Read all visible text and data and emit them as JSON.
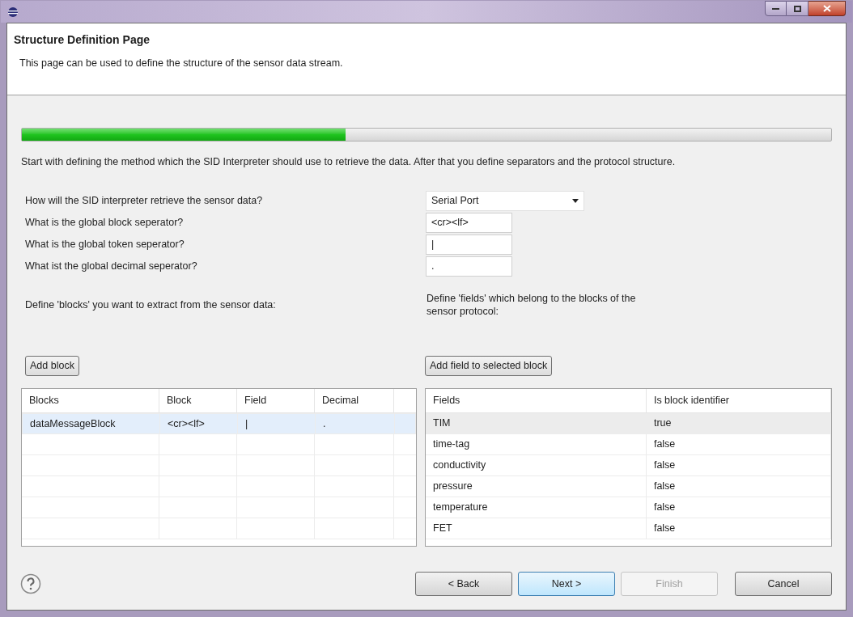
{
  "header": {
    "title": "Structure Definition Page",
    "description": "This page can be used to define the structure of the sensor data stream."
  },
  "progress": {
    "level": 0.4
  },
  "intro": "Start with defining the method which the SID Interpreter should use to retrieve the data. After that you define separators and the protocol structure.",
  "form": [
    {
      "kind": "dropdown",
      "label": "How will the SID interpreter retrieve the sensor data?",
      "value": "Serial Port"
    },
    {
      "kind": "text",
      "label": "What is the global block seperator?",
      "value": "<cr><lf>"
    },
    {
      "kind": "text",
      "label": "What is the global token seperator?",
      "value": "|"
    },
    {
      "kind": "text",
      "label": "What ist the global decimal seperator?",
      "value": "."
    }
  ],
  "blocks": {
    "prompt": "Define 'blocks' you want to extract from the sensor data:",
    "button": "Add block",
    "columns": [
      "Blocks",
      "Block",
      "Field",
      "Decimal"
    ],
    "rows": [
      {
        "cells": [
          "dataMessageBlock",
          "<cr><lf>",
          "|",
          "."
        ],
        "selected": true
      }
    ]
  },
  "fields": {
    "prompt": "Define 'fields' which belong to the blocks of the sensor protocol:",
    "button": "Add field to selected block",
    "columns": [
      "Fields",
      "Is block identifier"
    ],
    "rows": [
      {
        "cells": [
          "TIM",
          "true"
        ],
        "selected": true
      },
      {
        "cells": [
          "time-tag",
          "false"
        ],
        "selected": false
      },
      {
        "cells": [
          "conductivity",
          "false"
        ],
        "selected": false
      },
      {
        "cells": [
          "pressure",
          "false"
        ],
        "selected": false
      },
      {
        "cells": [
          "temperature",
          "false"
        ],
        "selected": false
      },
      {
        "cells": [
          "FET",
          "false"
        ],
        "selected": false
      }
    ]
  },
  "buttons": [
    {
      "label": "< Back",
      "disabled": false,
      "default": false
    },
    {
      "label": "Next >",
      "disabled": false,
      "default": true
    },
    {
      "label": "Finish",
      "disabled": true,
      "default": false
    },
    {
      "label": "Cancel",
      "disabled": false,
      "default": false
    }
  ]
}
